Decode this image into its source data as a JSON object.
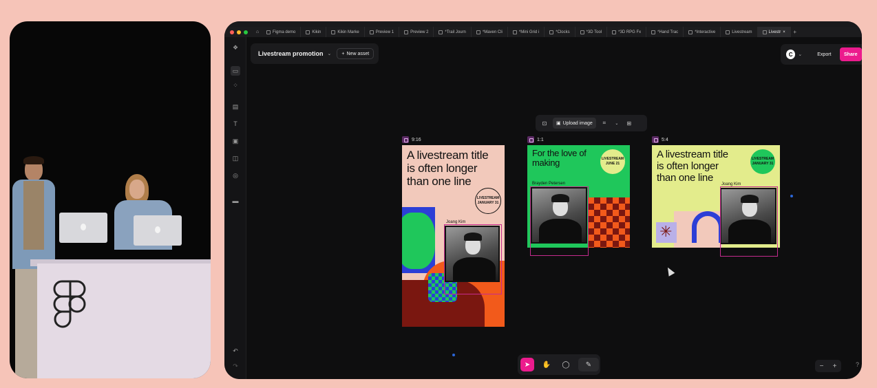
{
  "tabs": [
    {
      "label": "Figma demo",
      "active": false
    },
    {
      "label": "Kikin",
      "active": false
    },
    {
      "label": "Kikin Marke",
      "active": false
    },
    {
      "label": "Preview 1",
      "active": false
    },
    {
      "label": "Preview 2",
      "active": false
    },
    {
      "label": "*Trail Journ",
      "active": false
    },
    {
      "label": "*Maven Cli",
      "active": false
    },
    {
      "label": "*Mini Grid i",
      "active": false
    },
    {
      "label": "*Clocks",
      "active": false
    },
    {
      "label": "*3D Tool",
      "active": false
    },
    {
      "label": "*3D RPG Fx",
      "active": false
    },
    {
      "label": "*Hand Trac",
      "active": false
    },
    {
      "label": "*Interactive",
      "active": false
    },
    {
      "label": "Livestream",
      "active": false
    },
    {
      "label": "Livestr",
      "active": true
    }
  ],
  "project": {
    "title": "Livestream promotion",
    "new_asset": "New asset"
  },
  "actions": {
    "export": "Export",
    "share": "Share",
    "account_initial": "C"
  },
  "context_toolbar": {
    "upload": "Upload image"
  },
  "frames": [
    {
      "ratio": "9:16",
      "headline": [
        "A livestream title",
        "is often longer",
        "than one line"
      ],
      "name": "Joang Kim",
      "badge": "LIVESTREAM JANUARY 31"
    },
    {
      "ratio": "1:1",
      "headline": [
        "For the love of",
        "making"
      ],
      "name": "Brayden Petersen",
      "badge": "LIVESTREAM JUNE 21"
    },
    {
      "ratio": "5:4",
      "headline": [
        "A livestream title",
        "is often longer",
        "than one line"
      ],
      "name": "Joang Kim",
      "badge": "LIVESTREAM JANUARY 31"
    }
  ],
  "zoom": {
    "minus": "−",
    "plus": "+"
  },
  "help": "?",
  "colors": {
    "accent": "#ec1b8d",
    "green": "#1fc75b",
    "lime": "#e3ec8c",
    "peach": "#f2c9bb",
    "orange": "#f25a1b",
    "maroon": "#7a1710",
    "blue": "#2c3fd6"
  }
}
